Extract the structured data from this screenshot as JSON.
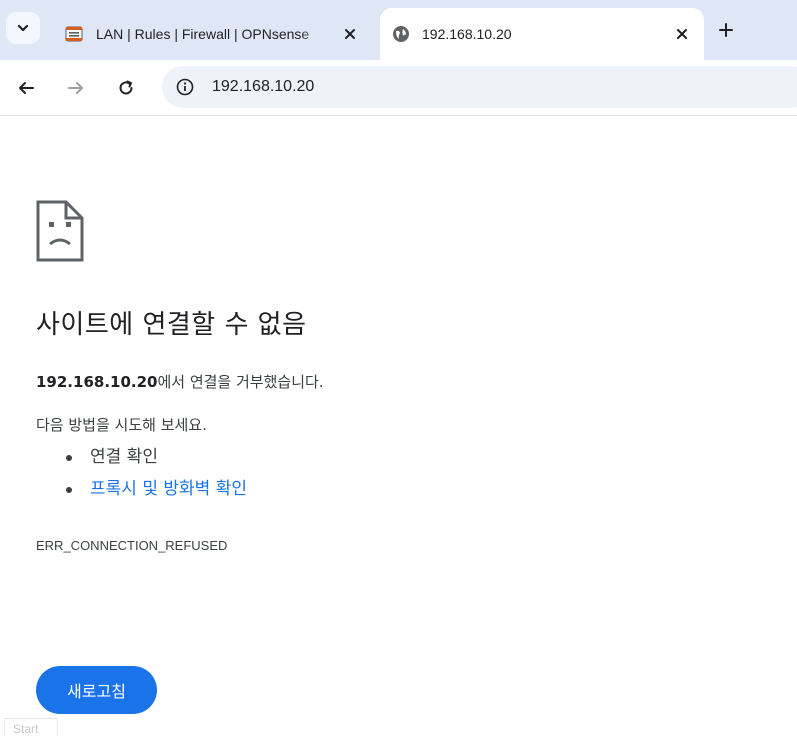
{
  "tabs": [
    {
      "title": "LAN | Rules | Firewall | OPNsense",
      "icon": "opnsense-icon",
      "active": false
    },
    {
      "title": "192.168.10.20",
      "icon": "globe-icon",
      "active": true
    }
  ],
  "toolbar": {
    "url": "192.168.10.20"
  },
  "error": {
    "title": "사이트에 연결할 수 없음",
    "host": "192.168.10.20",
    "message_suffix": "에서 연결을 거부했습니다.",
    "try_label": "다음 방법을 시도해 보세요.",
    "suggestions": [
      {
        "text": "연결 확인",
        "link": false
      },
      {
        "text": "프록시 및 방화벽 확인",
        "link": true
      }
    ],
    "code": "ERR_CONNECTION_REFUSED",
    "reload_label": "새로고침"
  },
  "taskbar": {
    "start_label": "Start"
  },
  "colors": {
    "tabstrip_bg": "#dfe7f6",
    "omnibox_bg": "#eef2f9",
    "link": "#1a73e8",
    "button_bg": "#1a73e8"
  }
}
